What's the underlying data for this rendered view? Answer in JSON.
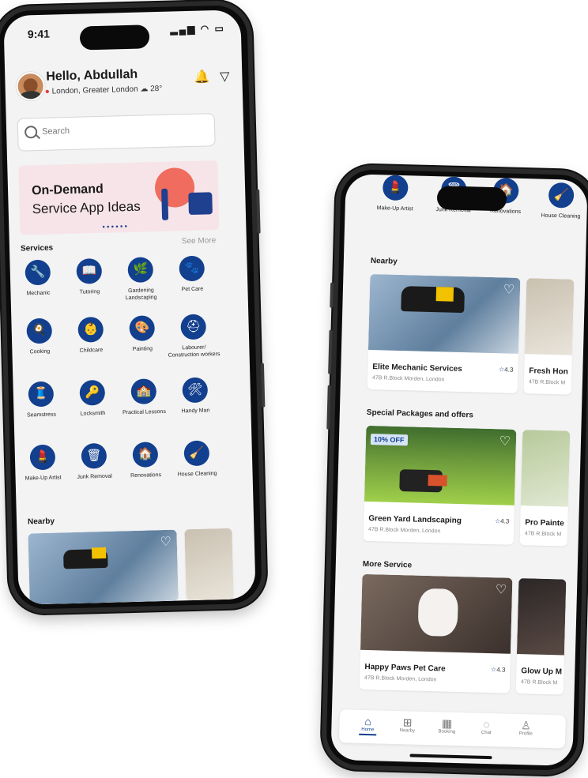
{
  "phone_a": {
    "status": {
      "time": "9:41",
      "icons": "▂▄▆ ◠ ▭"
    },
    "greeting": "Hello, Abdullah",
    "location": "London, Greater London",
    "weather": "28°",
    "search_placeholder": "Search",
    "banner": {
      "line1": "On-Demand",
      "line2": "Service App Ideas",
      "dots": "●●●●●●"
    },
    "services_title": "Services",
    "see_more": "See More",
    "services": [
      {
        "label": "Mechanic",
        "icon": "🔧"
      },
      {
        "label": "Tutoring",
        "icon": "📖"
      },
      {
        "label": "Gardening Landscaping",
        "icon": "🌿"
      },
      {
        "label": "Pet Care",
        "icon": "🐾"
      },
      {
        "label": "Cooking",
        "icon": "🍳"
      },
      {
        "label": "Childcare",
        "icon": "👶"
      },
      {
        "label": "Painting",
        "icon": "🎨"
      },
      {
        "label": "Labourer/ Construction workers",
        "icon": "⛑"
      },
      {
        "label": "Seamstress",
        "icon": "🧵"
      },
      {
        "label": "Locksmith",
        "icon": "🔑"
      },
      {
        "label": "Practical Lessons",
        "icon": "🏫"
      },
      {
        "label": "Handy Man",
        "icon": "🛠"
      },
      {
        "label": "Make-Up Artist",
        "icon": "💄"
      },
      {
        "label": "Junk Removal",
        "icon": "🗑"
      },
      {
        "label": "Renovations",
        "icon": "🏠"
      },
      {
        "label": "House Cleaning",
        "icon": "🧹"
      }
    ],
    "nearby_title": "Nearby"
  },
  "phone_b": {
    "top_services": [
      "Make-Up Artist",
      "Junk Removal",
      "Renovations",
      "House Cleaning"
    ],
    "nearby_title": "Nearby",
    "nearby": [
      {
        "name": "Elite Mechanic Services",
        "address": "47B R.Block Morden, London",
        "rating": "4.3"
      },
      {
        "name": "Fresh Hon",
        "address": "47B R.Block M"
      }
    ],
    "packages_title": "Special Packages and offers",
    "packages": [
      {
        "name": "Green Yard Landscaping",
        "address": "47B R.Block Morden, London",
        "rating": "4.3",
        "badge": "10% OFF"
      },
      {
        "name": "Pro Painte",
        "address": "47B R.Block M"
      }
    ],
    "more_title": "More Service",
    "more": [
      {
        "name": "Happy Paws Pet Care",
        "address": "47B R.Block Morden, London",
        "rating": "4.3"
      },
      {
        "name": "Glow Up M",
        "address": "47B R.Block M"
      }
    ],
    "tabs": [
      "Home",
      "Nearby",
      "Booking",
      "Chat",
      "Profile"
    ]
  },
  "colors": {
    "brand": "#123f8e",
    "background": "#f3f3f4",
    "accent_red": "#e23b3b"
  }
}
